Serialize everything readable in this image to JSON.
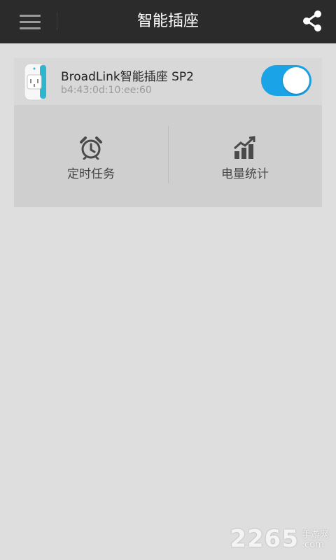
{
  "header": {
    "title": "智能插座",
    "menu_icon": "menu-icon",
    "share_icon": "share-icon"
  },
  "device": {
    "name": "BroadLink智能插座 SP2",
    "mac": "b4:43:0d:10:ee:60",
    "power_on": true,
    "icon": "smart-plug-icon"
  },
  "actions": [
    {
      "label": "定时任务",
      "icon": "alarm-clock-icon"
    },
    {
      "label": "电量统计",
      "icon": "bar-chart-trend-icon"
    }
  ],
  "watermark": {
    "number": "2265",
    "site_cn": "手游网",
    "site_com": ".com"
  },
  "colors": {
    "topbar": "#2b2b2b",
    "background": "#dedede",
    "toggle_on": "#1aa3e6",
    "card": "#cfcfcf"
  }
}
